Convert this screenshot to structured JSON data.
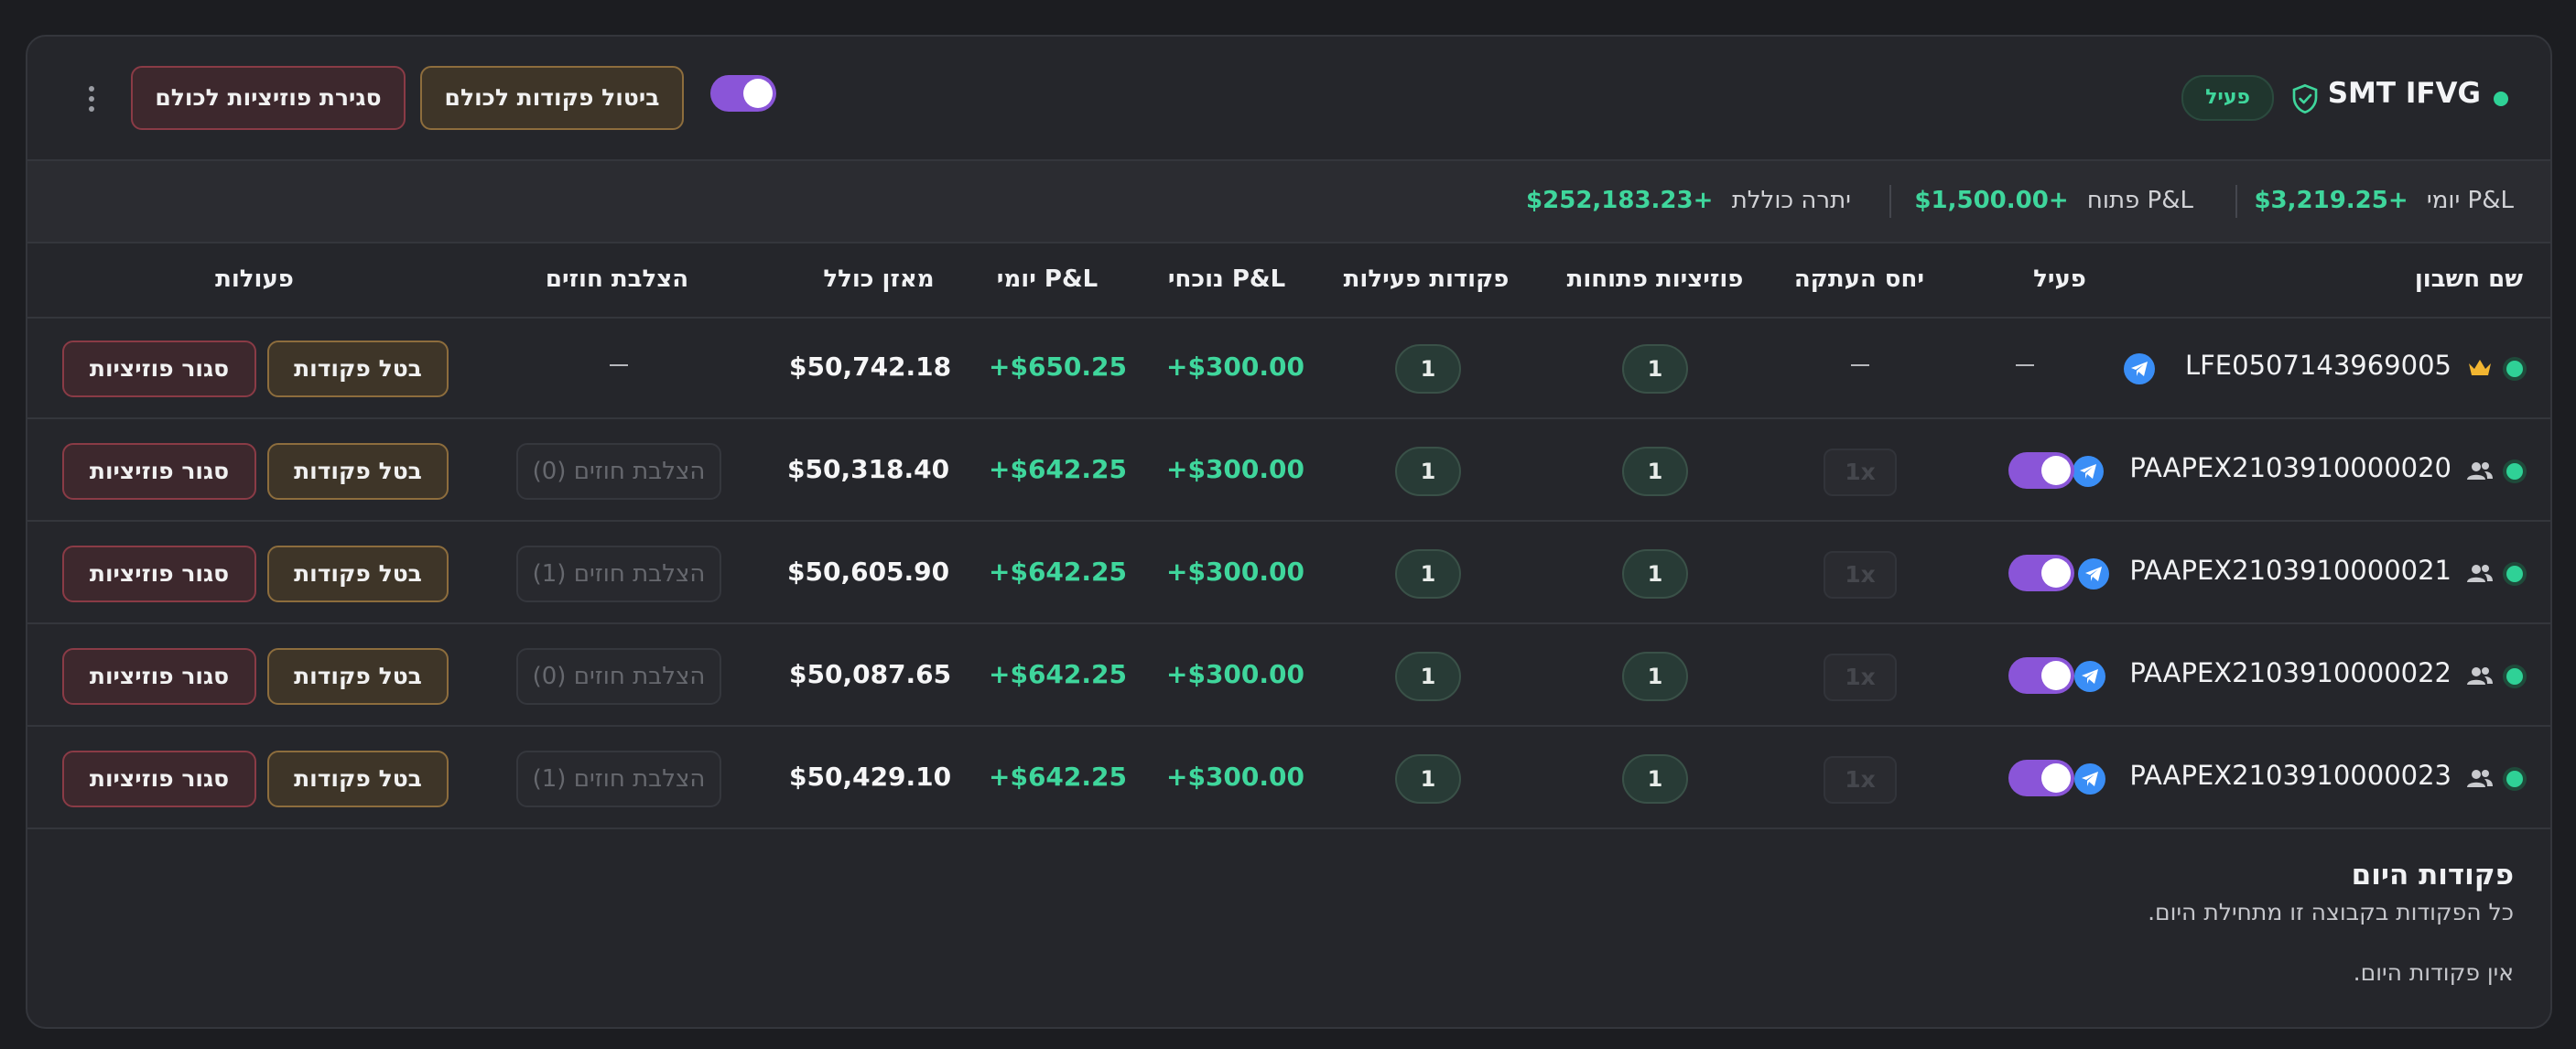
{
  "header": {
    "group_name": "SMT IFVG",
    "status_badge": "פעיל",
    "cancel_all_orders": "ביטול פקודות לכולם",
    "close_all_positions": "סגירת פוזיציות לכולם",
    "group_enabled": true
  },
  "stats": {
    "daily_pnl_label": "P&L יומי",
    "daily_pnl_value": "+$3,219.25",
    "open_pnl_label": "P&L פתוח",
    "open_pnl_value": "+$1,500.00",
    "total_balance_label": "יתרה כוללת",
    "total_balance_value": "+$252,183.23"
  },
  "table": {
    "columns": {
      "account_name": "שם חשבון",
      "active": "פעיל",
      "copy_ratio": "יחס העתקה",
      "open_positions": "פוזיציות פתוחות",
      "active_orders": "פקודות פעילות",
      "current_pnl": "P&L נוכחי",
      "daily_pnl": "P&L יומי",
      "total_balance": "מאזן כולל",
      "contract_crossing": "הצלבת חוזים",
      "actions": "פעולות"
    },
    "cancel_orders_label": "בטל פקודות",
    "close_positions_label": "סגור פוזיציות",
    "dash": "—",
    "rows": [
      {
        "account": "LFE0507143969005",
        "role_icon": "crown-icon",
        "active": "—",
        "copy_ratio": "—",
        "open_positions": "1",
        "active_orders": "1",
        "current_pnl": "+$300.00",
        "daily_pnl": "+$650.25",
        "balance": "$50,742.18",
        "crossing": "—"
      },
      {
        "account": "PAAPEX2103910000020",
        "role_icon": "users-icon",
        "active": true,
        "copy_ratio": "1x",
        "open_positions": "1",
        "active_orders": "1",
        "current_pnl": "+$300.00",
        "daily_pnl": "+$642.25",
        "balance": "$50,318.40",
        "crossing": "הצלבת חוזים (0)"
      },
      {
        "account": "PAAPEX2103910000021",
        "role_icon": "users-icon",
        "active": true,
        "copy_ratio": "1x",
        "open_positions": "1",
        "active_orders": "1",
        "current_pnl": "+$300.00",
        "daily_pnl": "+$642.25",
        "balance": "$50,605.90",
        "crossing": "הצלבת חוזים (1)"
      },
      {
        "account": "PAAPEX2103910000022",
        "role_icon": "users-icon",
        "active": true,
        "copy_ratio": "1x",
        "open_positions": "1",
        "active_orders": "1",
        "current_pnl": "+$300.00",
        "daily_pnl": "+$642.25",
        "balance": "$50,087.65",
        "crossing": "הצלבת חוזים (0)"
      },
      {
        "account": "PAAPEX2103910000023",
        "role_icon": "users-icon",
        "active": true,
        "copy_ratio": "1x",
        "open_positions": "1",
        "active_orders": "1",
        "current_pnl": "+$300.00",
        "daily_pnl": "+$642.25",
        "balance": "$50,429.10",
        "crossing": "הצלבת חוזים (1)"
      }
    ]
  },
  "todays_orders": {
    "title": "פקודות היום",
    "subtitle": "כל הפקודות בקבוצה זו מתחילת היום.",
    "empty": "אין פקודות היום."
  },
  "colors": {
    "accent_green": "#3fd69c",
    "toggle_purple": "#8a55d8",
    "telegram_blue": "#3a8ef6",
    "crown_gold": "#f2b531"
  }
}
